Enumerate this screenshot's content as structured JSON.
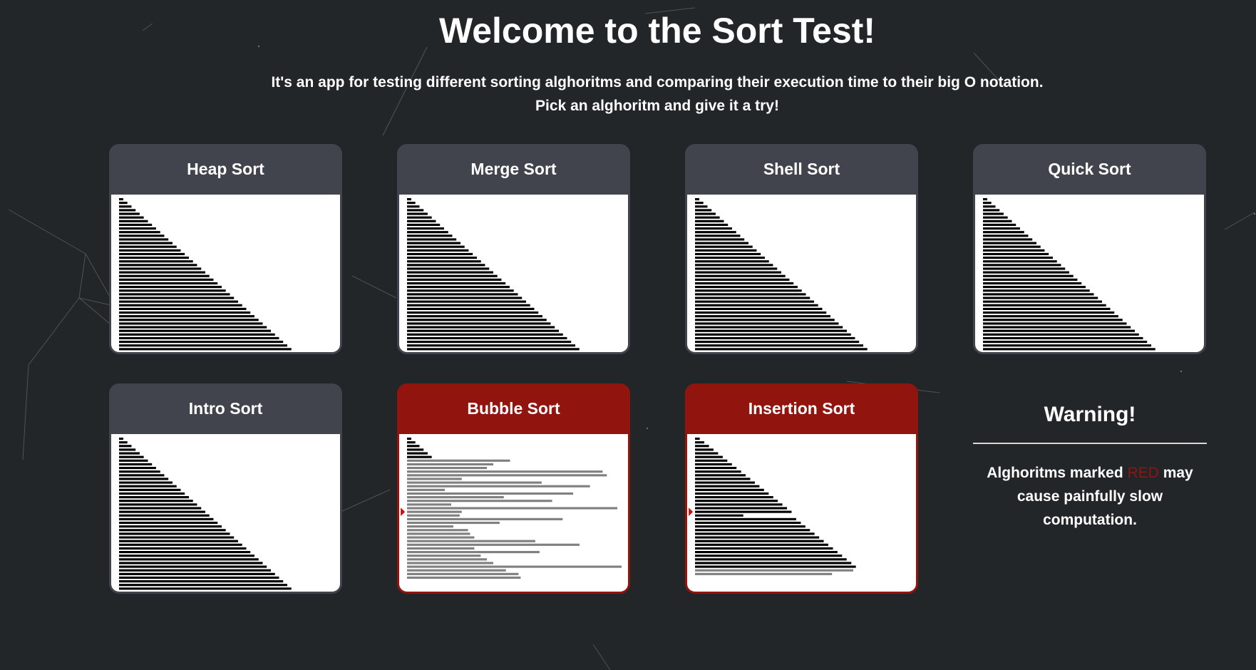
{
  "header": {
    "title": "Welcome to the Sort Test!",
    "subtitle_line1": "It's an app for testing different sorting alghoritms and comparing their execution time to their big O notation.",
    "subtitle_line2": "Pick an alghoritm and give it a try!"
  },
  "colors": {
    "background": "#222629",
    "card_header": "#41444d",
    "card_header_slow": "#92140f",
    "bar_sorted": "#000000",
    "bar_unsorted": "#808080",
    "pointer": "#e00000"
  },
  "cards": [
    {
      "name": "Heap Sort",
      "slow": false,
      "state": "sorted"
    },
    {
      "name": "Merge Sort",
      "slow": false,
      "state": "sorted"
    },
    {
      "name": "Shell Sort",
      "slow": false,
      "state": "sorted"
    },
    {
      "name": "Quick Sort",
      "slow": false,
      "state": "sorted"
    },
    {
      "name": "Intro Sort",
      "slow": false,
      "state": "sorted"
    },
    {
      "name": "Bubble Sort",
      "slow": true,
      "state": "partial",
      "sorted_count": 6,
      "pointer_row": 20,
      "unsorted_values": [
        0.47,
        0.39,
        0.36,
        0.91,
        0.93,
        0.24,
        0.62,
        0.85,
        0.16,
        0.77,
        0.44,
        0.67,
        0.19,
        0.98,
        0.24,
        0.23,
        0.72,
        0.42,
        0.2,
        0.27,
        0.28,
        0.3,
        0.59,
        0.8,
        0.3,
        0.61,
        0.33,
        0.36,
        0.39,
        1.0,
        0.45,
        0.51,
        0.52
      ]
    },
    {
      "name": "Insertion Sort",
      "slow": true,
      "state": "partial",
      "sorted_count": 35,
      "pointer_row": 20,
      "pointer_value": 0.28,
      "tail_values": [
        0.82,
        0.71
      ]
    }
  ],
  "warning": {
    "title": "Warning!",
    "text_before": "Alghoritms marked",
    "red_word": "RED",
    "text_after": "may cause painfully slow computation."
  }
}
